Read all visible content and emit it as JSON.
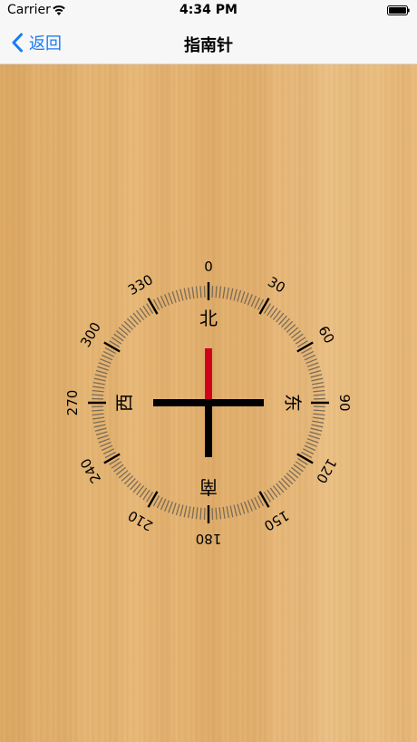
{
  "status_bar": {
    "carrier": "Carrier",
    "time": "4:34 PM",
    "wifi_icon": "wifi-icon",
    "battery_icon": "battery-icon"
  },
  "nav": {
    "back_label": "返回",
    "title": "指南针",
    "back_icon": "chevron-left-icon",
    "accent_color": "#1a7cf5"
  },
  "compass": {
    "heading": 0,
    "degree_labels": [
      "0",
      "30",
      "60",
      "90",
      "120",
      "150",
      "180",
      "210",
      "240",
      "270",
      "300",
      "330"
    ],
    "directions": {
      "north": "北",
      "east": "东",
      "south": "南",
      "west": "西"
    },
    "needle_north_color": "#d0021b",
    "needle_color": "#000000"
  }
}
